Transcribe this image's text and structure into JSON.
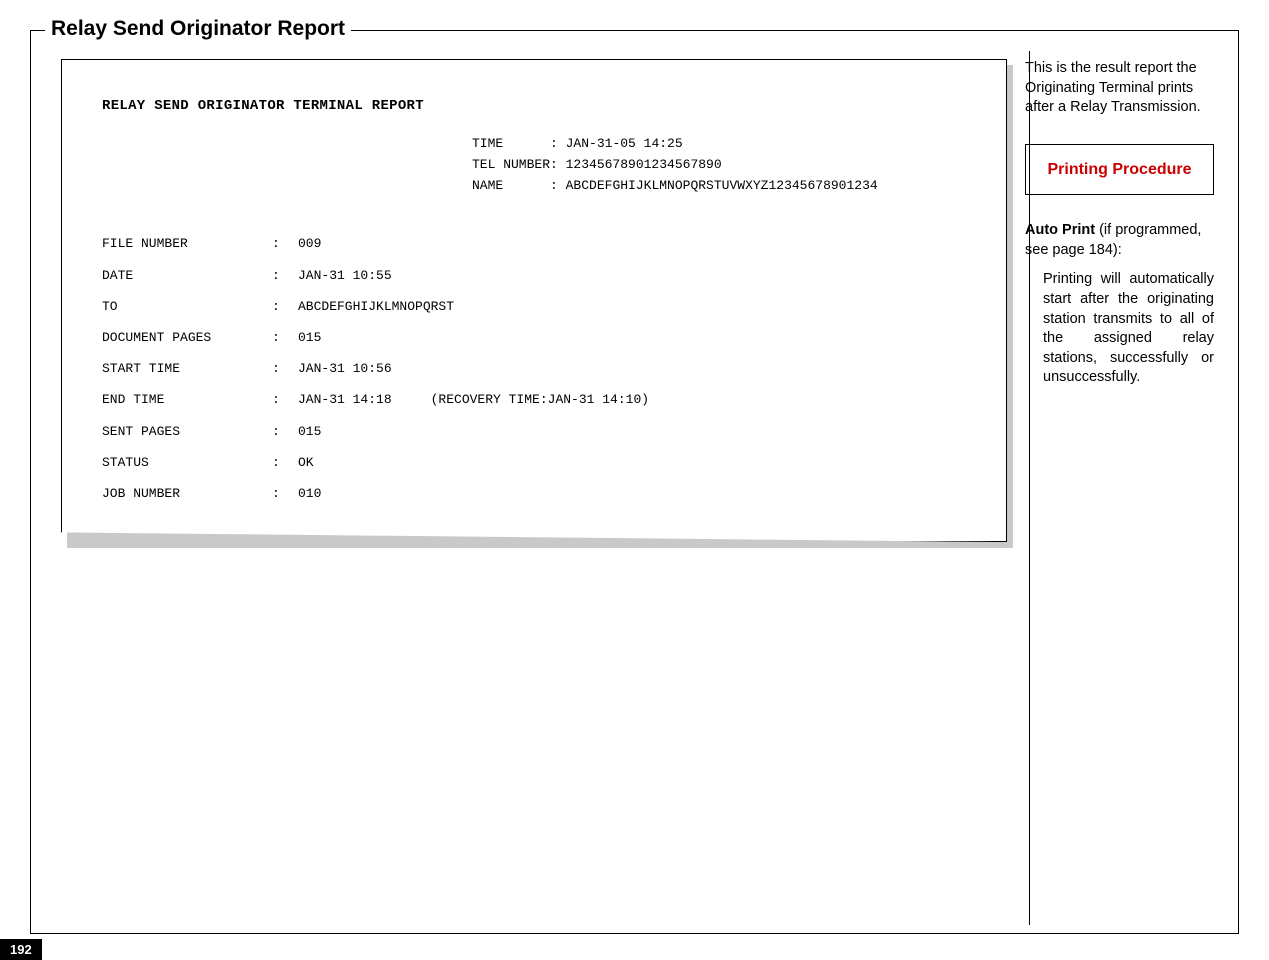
{
  "page_number": "192",
  "section_title": "Relay Send Originator Report",
  "report": {
    "title": "RELAY SEND ORIGINATOR TERMINAL REPORT",
    "meta": {
      "time_label": "TIME",
      "time_value": ": JAN-31-05 14:25",
      "tel_label": "TEL NUMBER",
      "tel_value": ": 12345678901234567890",
      "name_label": "NAME",
      "name_value": ": ABCDEFGHIJKLMNOPQRSTUVWXYZ12345678901234"
    },
    "rows": [
      {
        "label": "FILE NUMBER",
        "value": "009"
      },
      {
        "label": "DATE",
        "value": "JAN-31 10:55"
      },
      {
        "label": "TO",
        "value": "ABCDEFGHIJKLMNOPQRST"
      },
      {
        "label": "DOCUMENT PAGES",
        "value": "015"
      },
      {
        "label": "START TIME",
        "value": "JAN-31 10:56"
      },
      {
        "label": "END TIME",
        "value": "JAN-31 14:18     (RECOVERY TIME:JAN-31 14:10)"
      },
      {
        "label": "SENT PAGES",
        "value": "015"
      },
      {
        "label": "STATUS",
        "value": "OK"
      },
      {
        "label": "JOB NUMBER",
        "value": "010"
      }
    ]
  },
  "sidebar": {
    "intro": "This is the result report the Originating Terminal prints after a Relay Transmission.",
    "procedure_heading": "Printing Procedure",
    "auto_print_bold": "Auto Print",
    "auto_print_rest": " (if programmed, see page 184):",
    "body": "Printing will automatically start after the originating station transmits to all of the assigned relay stations, successfully or unsuccessfully."
  }
}
